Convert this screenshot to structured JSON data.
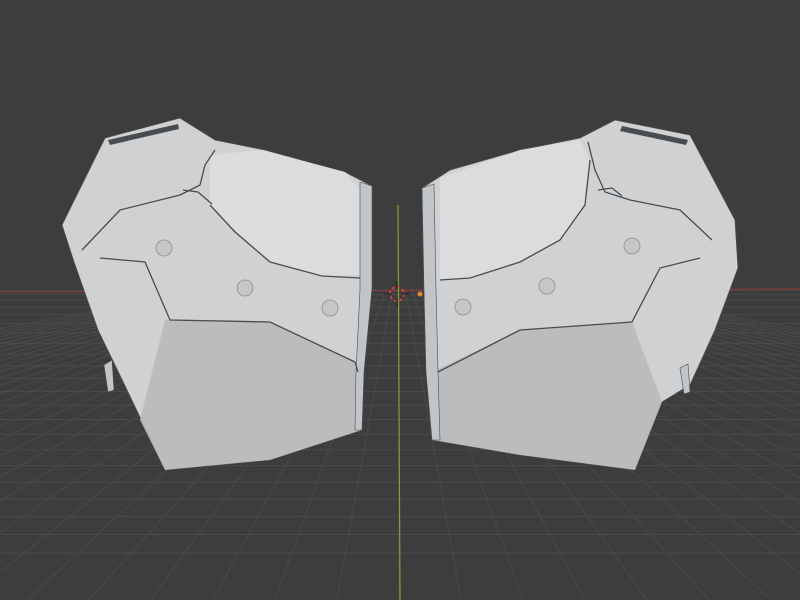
{
  "viewport": {
    "background_color": "#3d3d3d",
    "grid_line_color": "#4a4a4a",
    "x_axis_color": "#8a3b3b",
    "y_axis_color": "#7da33a",
    "mesh_color": "#cfd1d2",
    "mesh_shadow_color": "#b6b9bb",
    "mesh_edge_color": "#4a4d50"
  },
  "objects": [
    {
      "name": "armor-piece-left"
    },
    {
      "name": "armor-piece-right"
    }
  ],
  "gizmo": {
    "icon": "3d-cursor-icon",
    "ring_color": "#c8413b",
    "origin_color": "#e08a2c"
  }
}
